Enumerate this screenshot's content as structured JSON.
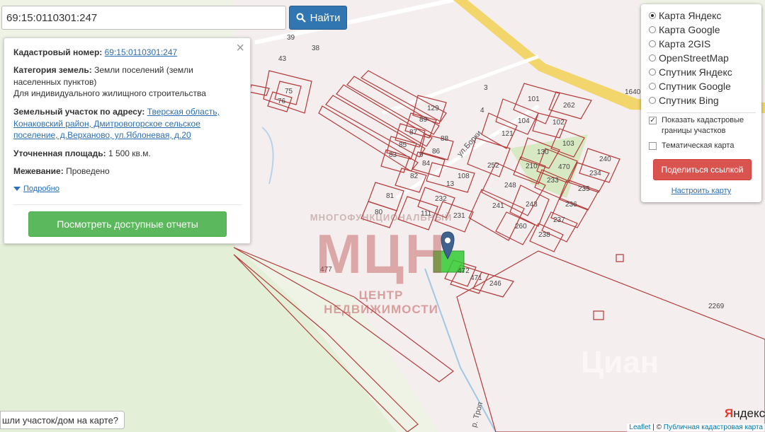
{
  "search": {
    "value": "69:15:0110301:247",
    "button_label": "Найти"
  },
  "info": {
    "cadastral_label": "Кадастровый номер:",
    "cadastral_number": "69:15:0110301:247",
    "category_label": "Категория земель:",
    "category_value_1": "Земли поселений (земли",
    "category_value_2": "населенных пунктов)",
    "category_value_3": "Для индивидуального жилищного строительства",
    "address_label": "Земельный участок по адресу:",
    "address_1": "Тверская область,",
    "address_2": "Конаковский район, Дмитровогорское сельское",
    "address_3": "поселение, д.Верханово, ул.Яблоневая, д.20",
    "area_label": "Уточненная площадь:",
    "area_value": "1 500 кв.м.",
    "survey_label": "Межевание:",
    "survey_value": "Проведено",
    "more_label": "Подробно",
    "reports_button": "Посмотреть доступные отчеты"
  },
  "layers": {
    "items": [
      {
        "label": "Карта Яндекс",
        "selected": true
      },
      {
        "label": "Карта Google",
        "selected": false
      },
      {
        "label": "Карта 2GIS",
        "selected": false
      },
      {
        "label": "OpenStreetMap",
        "selected": false
      },
      {
        "label": "Спутник Яндекс",
        "selected": false
      },
      {
        "label": "Спутник Google",
        "selected": false
      },
      {
        "label": "Спутник Bing",
        "selected": false
      }
    ],
    "show_cadastral_1": "Показать кадастровые",
    "show_cadastral_2": "границы участков",
    "show_cadastral_checked": true,
    "thematic_map": "Тематическая карта",
    "thematic_checked": false,
    "share_button": "Поделиться ссылкой",
    "configure_link": "Настроить карту"
  },
  "map": {
    "street_borki": "ул.Борки",
    "river": "р. Троп",
    "road_km": "1640",
    "plot_labels": [
      "129",
      "89",
      "87",
      "88",
      "85",
      "86",
      "83",
      "84",
      "82",
      "108",
      "121",
      "252",
      "104",
      "101",
      "262",
      "102",
      "103",
      "130",
      "210",
      "470",
      "233",
      "234",
      "240",
      "235",
      "236",
      "237",
      "238",
      "248",
      "243",
      "241",
      "260",
      "232",
      "231",
      "81",
      "80",
      "111",
      "472",
      "471",
      "246",
      "477",
      "2269",
      "75",
      "76",
      "39",
      "38",
      "43",
      "3",
      "4",
      "9",
      "13"
    ],
    "watermark_top": "МНОГОФУНКЦИОНАЛЬНЫЙ",
    "watermark_mid": "МЦН",
    "watermark_bottom": "ЦЕНТР НЕДВИЖИМОСТИ",
    "cian_mark": "Циан",
    "yandex_logo_red": "Я",
    "yandex_logo_rest": "ндекс"
  },
  "bottom_hint": "шли участок/дом на карте?",
  "attribution": {
    "leaflet": "Leaflet",
    "sep": " | © ",
    "cadastral_map": "Публичная кадастровая карта"
  },
  "colors": {
    "plot_border": "#b33a3a",
    "selected_plot": "#33cc33",
    "road": "#f2d25c",
    "green_area": "#dfeecf"
  }
}
